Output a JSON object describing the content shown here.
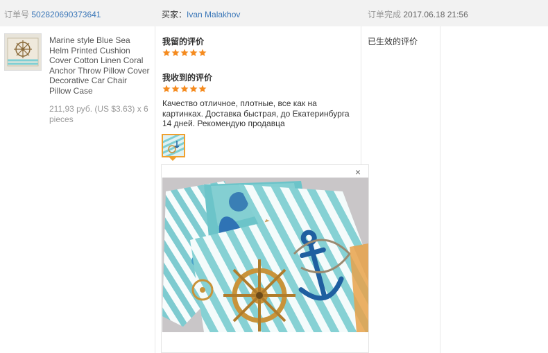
{
  "header": {
    "order_label": "订单号",
    "order_number": "502820690373641",
    "buyer_label": "买家：",
    "buyer_name": "Ivan Malakhov",
    "completed_label": "订单完成",
    "completed_time": "2017.06.18 21:56"
  },
  "product": {
    "title": "Marine style Blue Sea Helm Printed Cushion Cover Cotton Linen Coral Anchor Throw Pillow Cover Decorative Car Chair Pillow Case",
    "price": "211,93 руб. (US $3.63) x 6 pieces"
  },
  "my_review": {
    "label": "我留的评价",
    "rating": 5,
    "rating_max": 5
  },
  "received_review": {
    "label": "我收到的评价",
    "rating": 5,
    "rating_max": 5,
    "text": "Качество отличное, плотные, все как на картинках. Доставка быстрая, до Екатеринбурга 14 дней. Рекомендую продавца"
  },
  "preview": {
    "close_symbol": "×"
  },
  "status": {
    "label": "已生效的评价"
  },
  "colors": {
    "link": "#3b77b8",
    "star": "#f58b1f",
    "thumb_border": "#f0a02e",
    "header_bg": "#f2f2f2",
    "stripe": "#7fcfd3",
    "anchor": "#1f5fa0",
    "helm": "#c8933a"
  }
}
